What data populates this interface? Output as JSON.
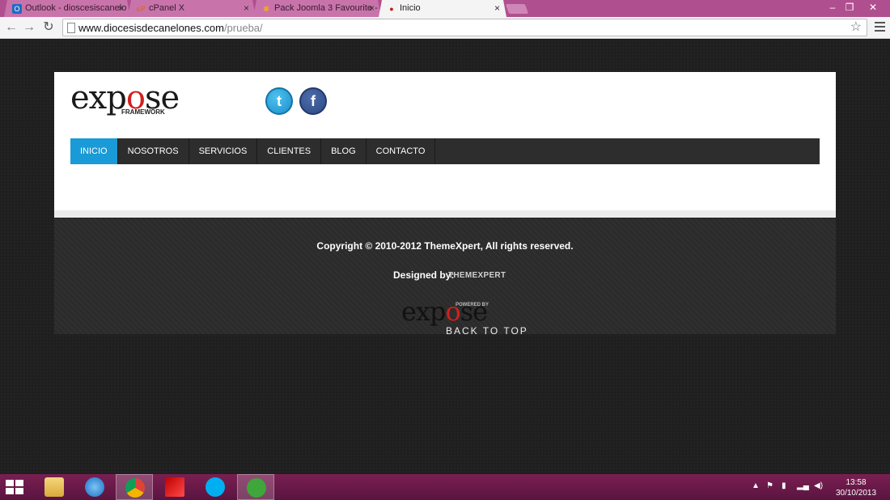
{
  "browser": {
    "tabs": [
      {
        "title": "Outlook - dioscesiscanelo",
        "icon": "outlook-icon",
        "active": false
      },
      {
        "title": "cPanel X",
        "icon": "cpanel-icon",
        "active": false
      },
      {
        "title": "Pack Joomla 3 Favourite -",
        "icon": "joomla-icon",
        "active": false
      },
      {
        "title": "Inicio",
        "icon": "flame-icon",
        "active": true
      }
    ],
    "close_glyph": "×",
    "url_host": "www.diocesisdecanelones.com",
    "url_path": "/prueba/"
  },
  "site": {
    "logo_text_before": "exp",
    "logo_o": "o",
    "logo_text_after": "se",
    "logo_sub": "FRAMEWORK",
    "social": [
      {
        "name": "twitter",
        "glyph": "t"
      },
      {
        "name": "facebook",
        "glyph": "f"
      }
    ],
    "nav": [
      "INICIO",
      "NOSOTROS",
      "SERVICIOS",
      "CLIENTES",
      "BLOG",
      "CONTACTO"
    ],
    "active_nav": "INICIO",
    "accent_color": "#1a9ad6"
  },
  "footer": {
    "copyright": "Copyright © 2010-2012 ThemeXpert, All rights reserved.",
    "designed_by": "Designed by:",
    "designer_brand": "THEMEXPERT",
    "powered_by": "POWERED BY",
    "footer_logo_before": "exp",
    "footer_logo_o": "o",
    "footer_logo_after": "se",
    "back_to_top": "BACK TO TOP"
  },
  "taskbar": {
    "apps": [
      "file-explorer-icon",
      "internet-explorer-icon",
      "chrome-icon",
      "filezilla-icon",
      "skype-icon",
      "utorrent-icon"
    ],
    "active_app": "chrome-icon",
    "time": "13:58",
    "date": "30/10/2013"
  }
}
